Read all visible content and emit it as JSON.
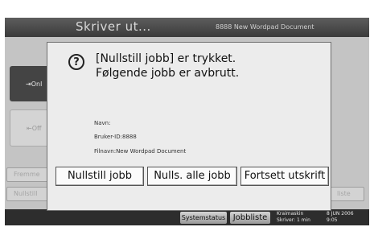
{
  "window": {
    "title": "Skriver ut...",
    "document_title": "8888 New Wordpad Document"
  },
  "side": {
    "online_label": "⇥Onl",
    "offline_label": "⇤Off"
  },
  "background": {
    "prev_label": "Fremme",
    "reset_label": "Nullstill",
    "list_label": "liste"
  },
  "status_bar": {
    "system_status": "Systemstatus",
    "job_list": "Jobbliste",
    "info_left_1": "Kraimaskin",
    "info_left_2": "Skriver: 1 min",
    "info_right_1": "8 JUN 2006",
    "info_right_2": "9:05"
  },
  "dialog": {
    "warning_icon_glyph": "?",
    "message_line1": "[Nullstill jobb] er trykket.",
    "message_line2": "Følgende jobb er avbrutt.",
    "name_label": "Navn:",
    "user_id": "Bruker-ID:8888",
    "filename": "Filnavn:New Wordpad Document",
    "buttons": {
      "reset_job": "Nullstill jobb",
      "reset_all": "Nulls. alle jobb",
      "continue": "Fortsett utskrift"
    }
  }
}
